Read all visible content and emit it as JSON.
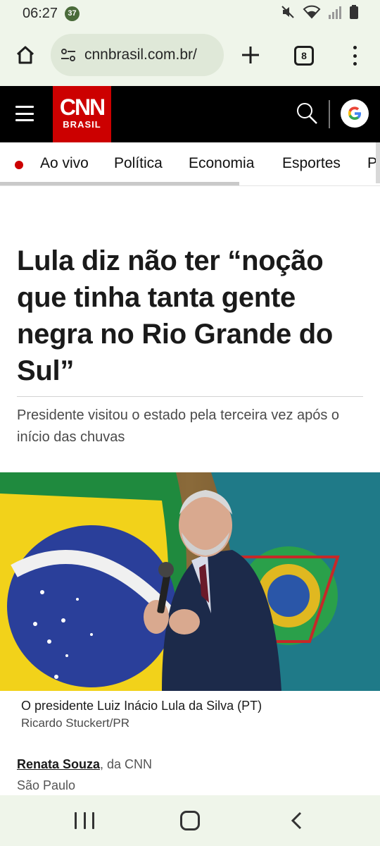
{
  "status_bar": {
    "time": "06:27",
    "notification_badge": "37",
    "icons": [
      "mute-icon",
      "wifi-icon",
      "signal-icon",
      "battery-icon"
    ]
  },
  "browser": {
    "url": "cnnbrasil.com.br/",
    "tab_count": "8"
  },
  "site_header": {
    "logo_cnn": "CNN",
    "logo_sub": "BRASIL",
    "brand_color": "#cc0000"
  },
  "section_nav": {
    "items": [
      "Ao vivo",
      "Política",
      "Economia",
      "Esportes",
      "Po"
    ]
  },
  "article": {
    "headline": "Lula diz não ter “noção que tinha tanta gente negra no Rio Grande do Sul”",
    "subhead": "Presidente visitou o estado pela terceira vez após o início das chuvas",
    "image_caption": "O presidente Luiz Inácio Lula da Silva (PT)",
    "image_credit": "Ricardo Stuckert/PR",
    "author": "Renata Souza",
    "author_suffix": ", da CNN",
    "location": "São Paulo"
  }
}
